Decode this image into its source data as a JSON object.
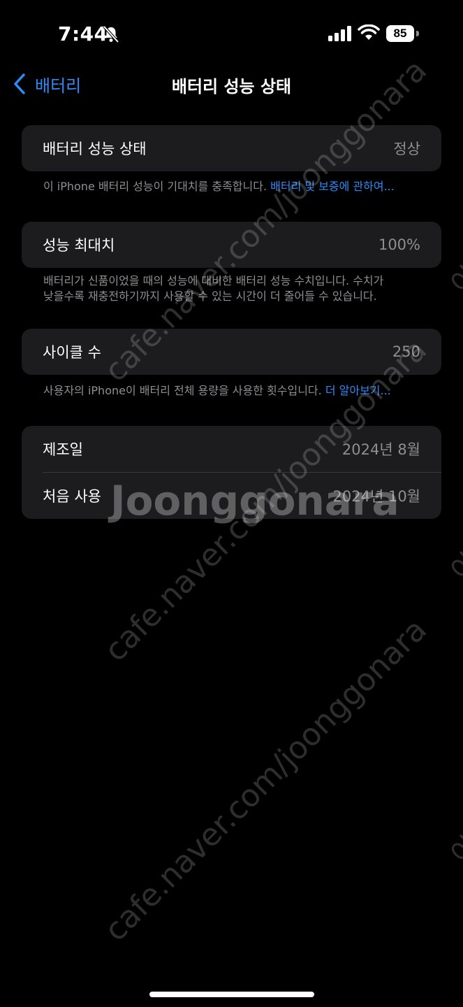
{
  "status_bar": {
    "time": "7:44",
    "battery_level": "85",
    "icons": [
      "bell-slash-icon",
      "cellular-signal-icon",
      "wifi-icon",
      "battery-icon"
    ]
  },
  "nav": {
    "back_label": "배터리",
    "title": "배터리 성능 상태"
  },
  "health": {
    "label": "배터리 성능 상태",
    "value": "정상",
    "footnote_text": "이 iPhone 배터리 성능이 기대치를 충족합니다. ",
    "footnote_link": "배터리 및 보증에 관하여..."
  },
  "max_capacity": {
    "label": "성능 최대치",
    "value": "100%",
    "footnote_line1": "배터리가 신품이었을 때의 성능에 대비한 배터리 성능 수치입니다. 수치가",
    "footnote_line2": "낮을수록 재충전하기까지 사용할 수 있는 시간이 더 줄어들 수 있습니다."
  },
  "cycle_count": {
    "label": "사이클 수",
    "value": "250",
    "footnote_text": "사용자의 iPhone이 배터리 전체 용량을 사용한 횟수입니다. ",
    "footnote_link": "더 알아보기..."
  },
  "dates": {
    "manufacture_label": "제조일",
    "manufacture_value": "2024년 8월",
    "first_use_label": "처음 사용",
    "first_use_value": "2024년 10월"
  },
  "watermark": {
    "url": "cafe.naver.com/joonggonara",
    "brand": "Joonggonara",
    "side": "아"
  },
  "colors": {
    "background": "#000000",
    "card": "#1c1c1e",
    "accent": "#2e8bf7",
    "secondary_text": "#8e8e93"
  }
}
